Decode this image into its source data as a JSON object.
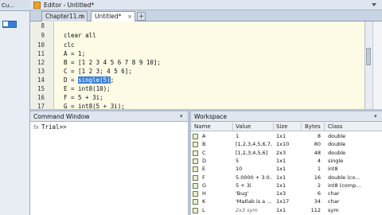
{
  "left_panel": {
    "title": "Cu..."
  },
  "editor": {
    "title": "Editor - Untitled*",
    "tabs": [
      {
        "label": "Chapter11.m"
      },
      {
        "label": "Untitled*"
      }
    ],
    "add_tab": "+",
    "lines": [
      {
        "num": "9",
        "text": "clear all"
      },
      {
        "num": "10",
        "text": "clc"
      },
      {
        "num": "11",
        "text": "A = 1;"
      },
      {
        "num": "12",
        "text": "B = [1 2 3 4 5 6 7 8 9 10];"
      },
      {
        "num": "13",
        "text": "C = [1 2 3; 4 5 6];"
      },
      {
        "num": "14",
        "pre": "D = ",
        "hl": "single(5)",
        "post": ";"
      },
      {
        "num": "15",
        "text": "E = int8(10);"
      },
      {
        "num": "16",
        "text": "F = 5 + 3i;"
      },
      {
        "num": "17",
        "text": "G = int8(5 + 3i);"
      }
    ],
    "first_num": "8"
  },
  "command_window": {
    "title": "Command Window",
    "fx": "fx",
    "prompt": "Trial>>"
  },
  "workspace": {
    "title": "Workspace",
    "columns": [
      "Name",
      "Value",
      "Size",
      "Bytes",
      "Class"
    ],
    "rows": [
      {
        "name": "A",
        "value": "1",
        "size": "1x1",
        "bytes": "8",
        "class": "double"
      },
      {
        "name": "B",
        "value": "[1,2,3,4,5,6,7,...",
        "size": "1x10",
        "bytes": "80",
        "class": "double"
      },
      {
        "name": "C",
        "value": "[1,2,3;4,5,6]",
        "size": "2x3",
        "bytes": "48",
        "class": "double"
      },
      {
        "name": "D",
        "value": "5",
        "size": "1x1",
        "bytes": "4",
        "class": "single"
      },
      {
        "name": "E",
        "value": "10",
        "size": "1x1",
        "bytes": "1",
        "class": "int8"
      },
      {
        "name": "F",
        "value": "5.0000 + 3.0...",
        "size": "1x1",
        "bytes": "16",
        "class": "double (co..."
      },
      {
        "name": "G",
        "value": "5 + 3i",
        "size": "1x1",
        "bytes": "2",
        "class": "int8 (comp..."
      },
      {
        "name": "H",
        "value": "'Bug'",
        "size": "1x3",
        "bytes": "6",
        "class": "char"
      },
      {
        "name": "K",
        "value": "'Matlab is a ...",
        "size": "1x17",
        "bytes": "34",
        "class": "char"
      },
      {
        "name": "L",
        "value": "2x3 sym",
        "size": "1x1",
        "bytes": "112",
        "class": "sym"
      }
    ]
  }
}
